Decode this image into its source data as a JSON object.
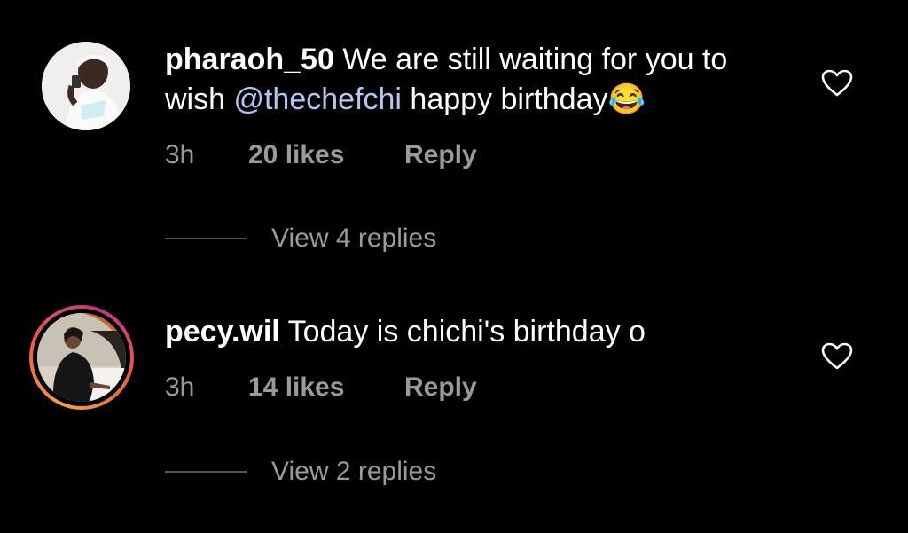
{
  "comments": [
    {
      "username": "pharaoh_50",
      "text_before": "We are still waiting for you to wish ",
      "mention": "@thechefchi",
      "text_after": " happy birthday😂",
      "time": "3h",
      "likes": "20 likes",
      "reply_label": "Reply",
      "view_replies": "View 4 replies",
      "avatar_has_story_ring": false,
      "liked": false
    },
    {
      "username": "pecy.wil",
      "text_before": "Today is chichi's birthday o",
      "mention": "",
      "text_after": "",
      "time": "3h",
      "likes": "14 likes",
      "reply_label": "Reply",
      "view_replies": "View 2 replies",
      "avatar_has_story_ring": true,
      "liked": false
    }
  ],
  "colors": {
    "background": "#000000",
    "text": "#ffffff",
    "secondary_text": "#9a9a9a",
    "mention": "#b4c7f2",
    "story_ring": [
      "#f9a03a",
      "#e95950",
      "#c13584"
    ]
  },
  "icons": {
    "like": "heart-outline-icon"
  }
}
